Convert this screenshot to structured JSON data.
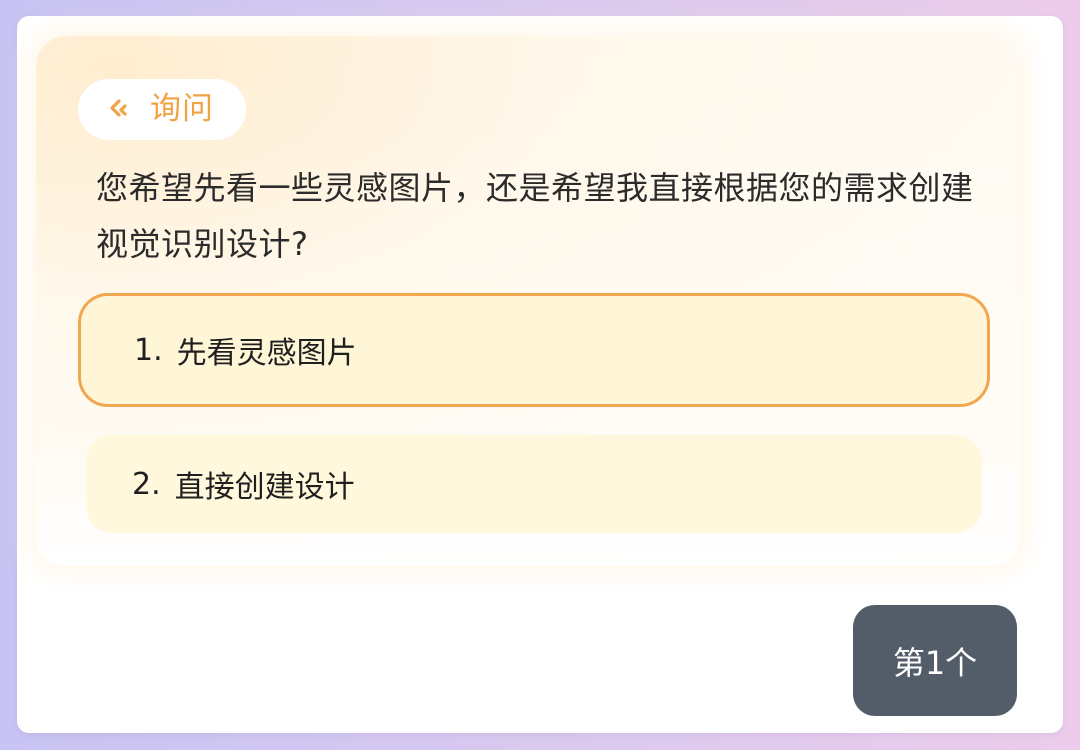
{
  "tag": {
    "label": "询问",
    "icon": "double-chevron-left-icon",
    "color": "#f0a245"
  },
  "question": "您希望先看一些灵感图片，还是希望我直接根据您的需求创建视觉识别设计?",
  "options": [
    {
      "number": "1.",
      "label": "先看灵感图片",
      "selected": true
    },
    {
      "number": "2.",
      "label": "直接创建设计",
      "selected": false
    }
  ],
  "counter_button": {
    "label": "第1个"
  },
  "colors": {
    "accent": "#f0a74f",
    "option_background": "#fff6d8",
    "button_background": "#535c69"
  }
}
